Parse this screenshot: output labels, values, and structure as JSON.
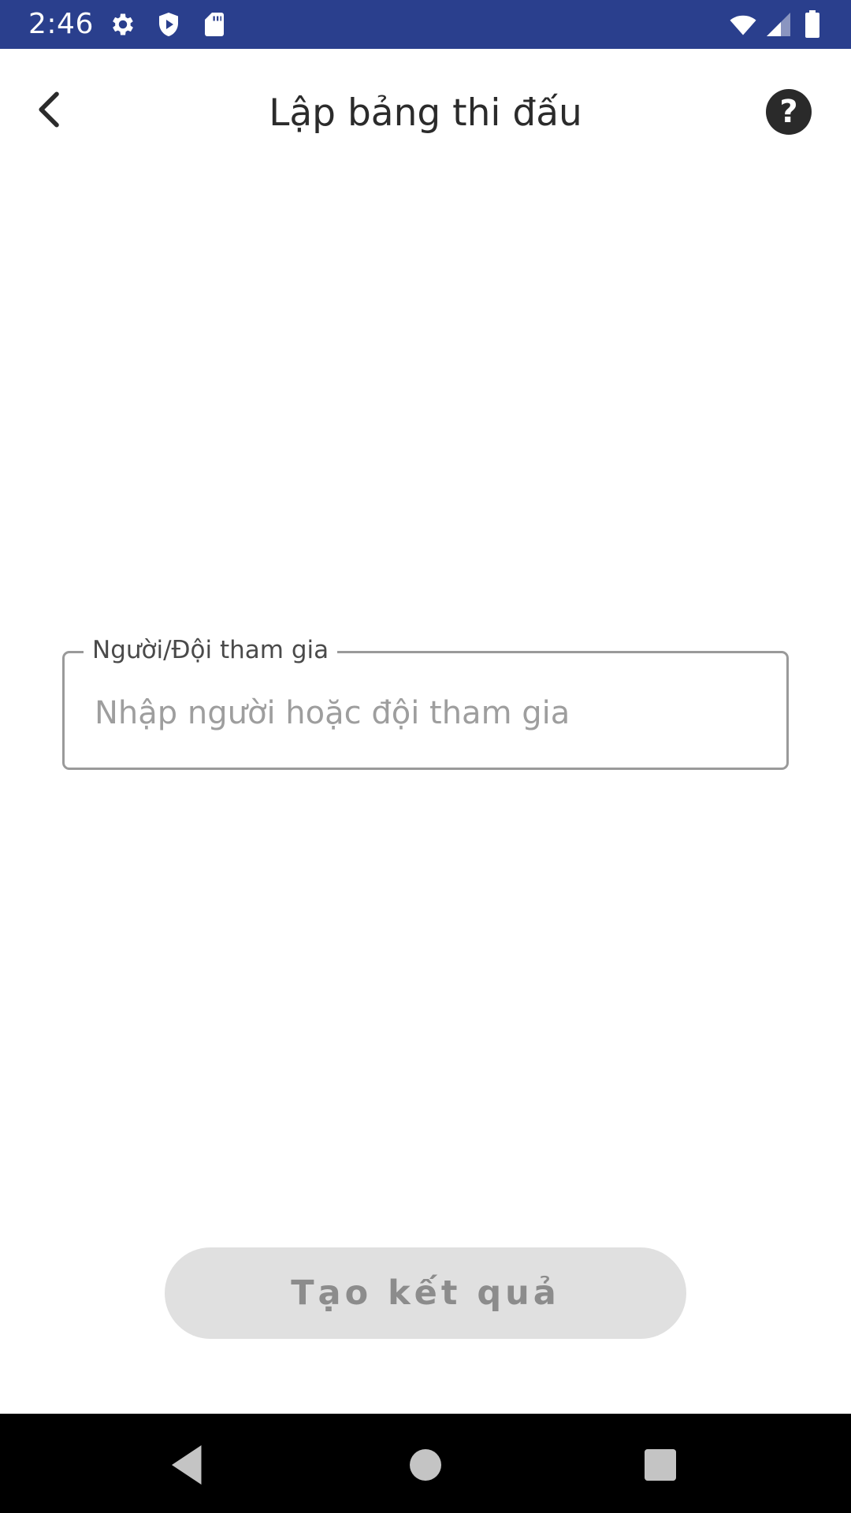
{
  "status_bar": {
    "time": "2:46",
    "background_color": "#2a3f8d",
    "left_icons": [
      "settings-gear-icon",
      "shield-play-icon",
      "sd-card-icon"
    ],
    "right_icons": [
      "wifi-icon",
      "cell-signal-icon",
      "battery-icon"
    ]
  },
  "app_bar": {
    "title": "Lập bảng thi đấu",
    "back_icon": "chevron-left-icon",
    "help_label": "?"
  },
  "participants_field": {
    "label": "Người/Đội tham gia",
    "placeholder": "Nhập người hoặc đội tham gia",
    "value": ""
  },
  "create_button": {
    "label": "Tạo kết quả",
    "enabled": false
  },
  "nav_bar": {
    "buttons": [
      "back-triangle-icon",
      "home-circle-icon",
      "recents-square-icon"
    ]
  }
}
